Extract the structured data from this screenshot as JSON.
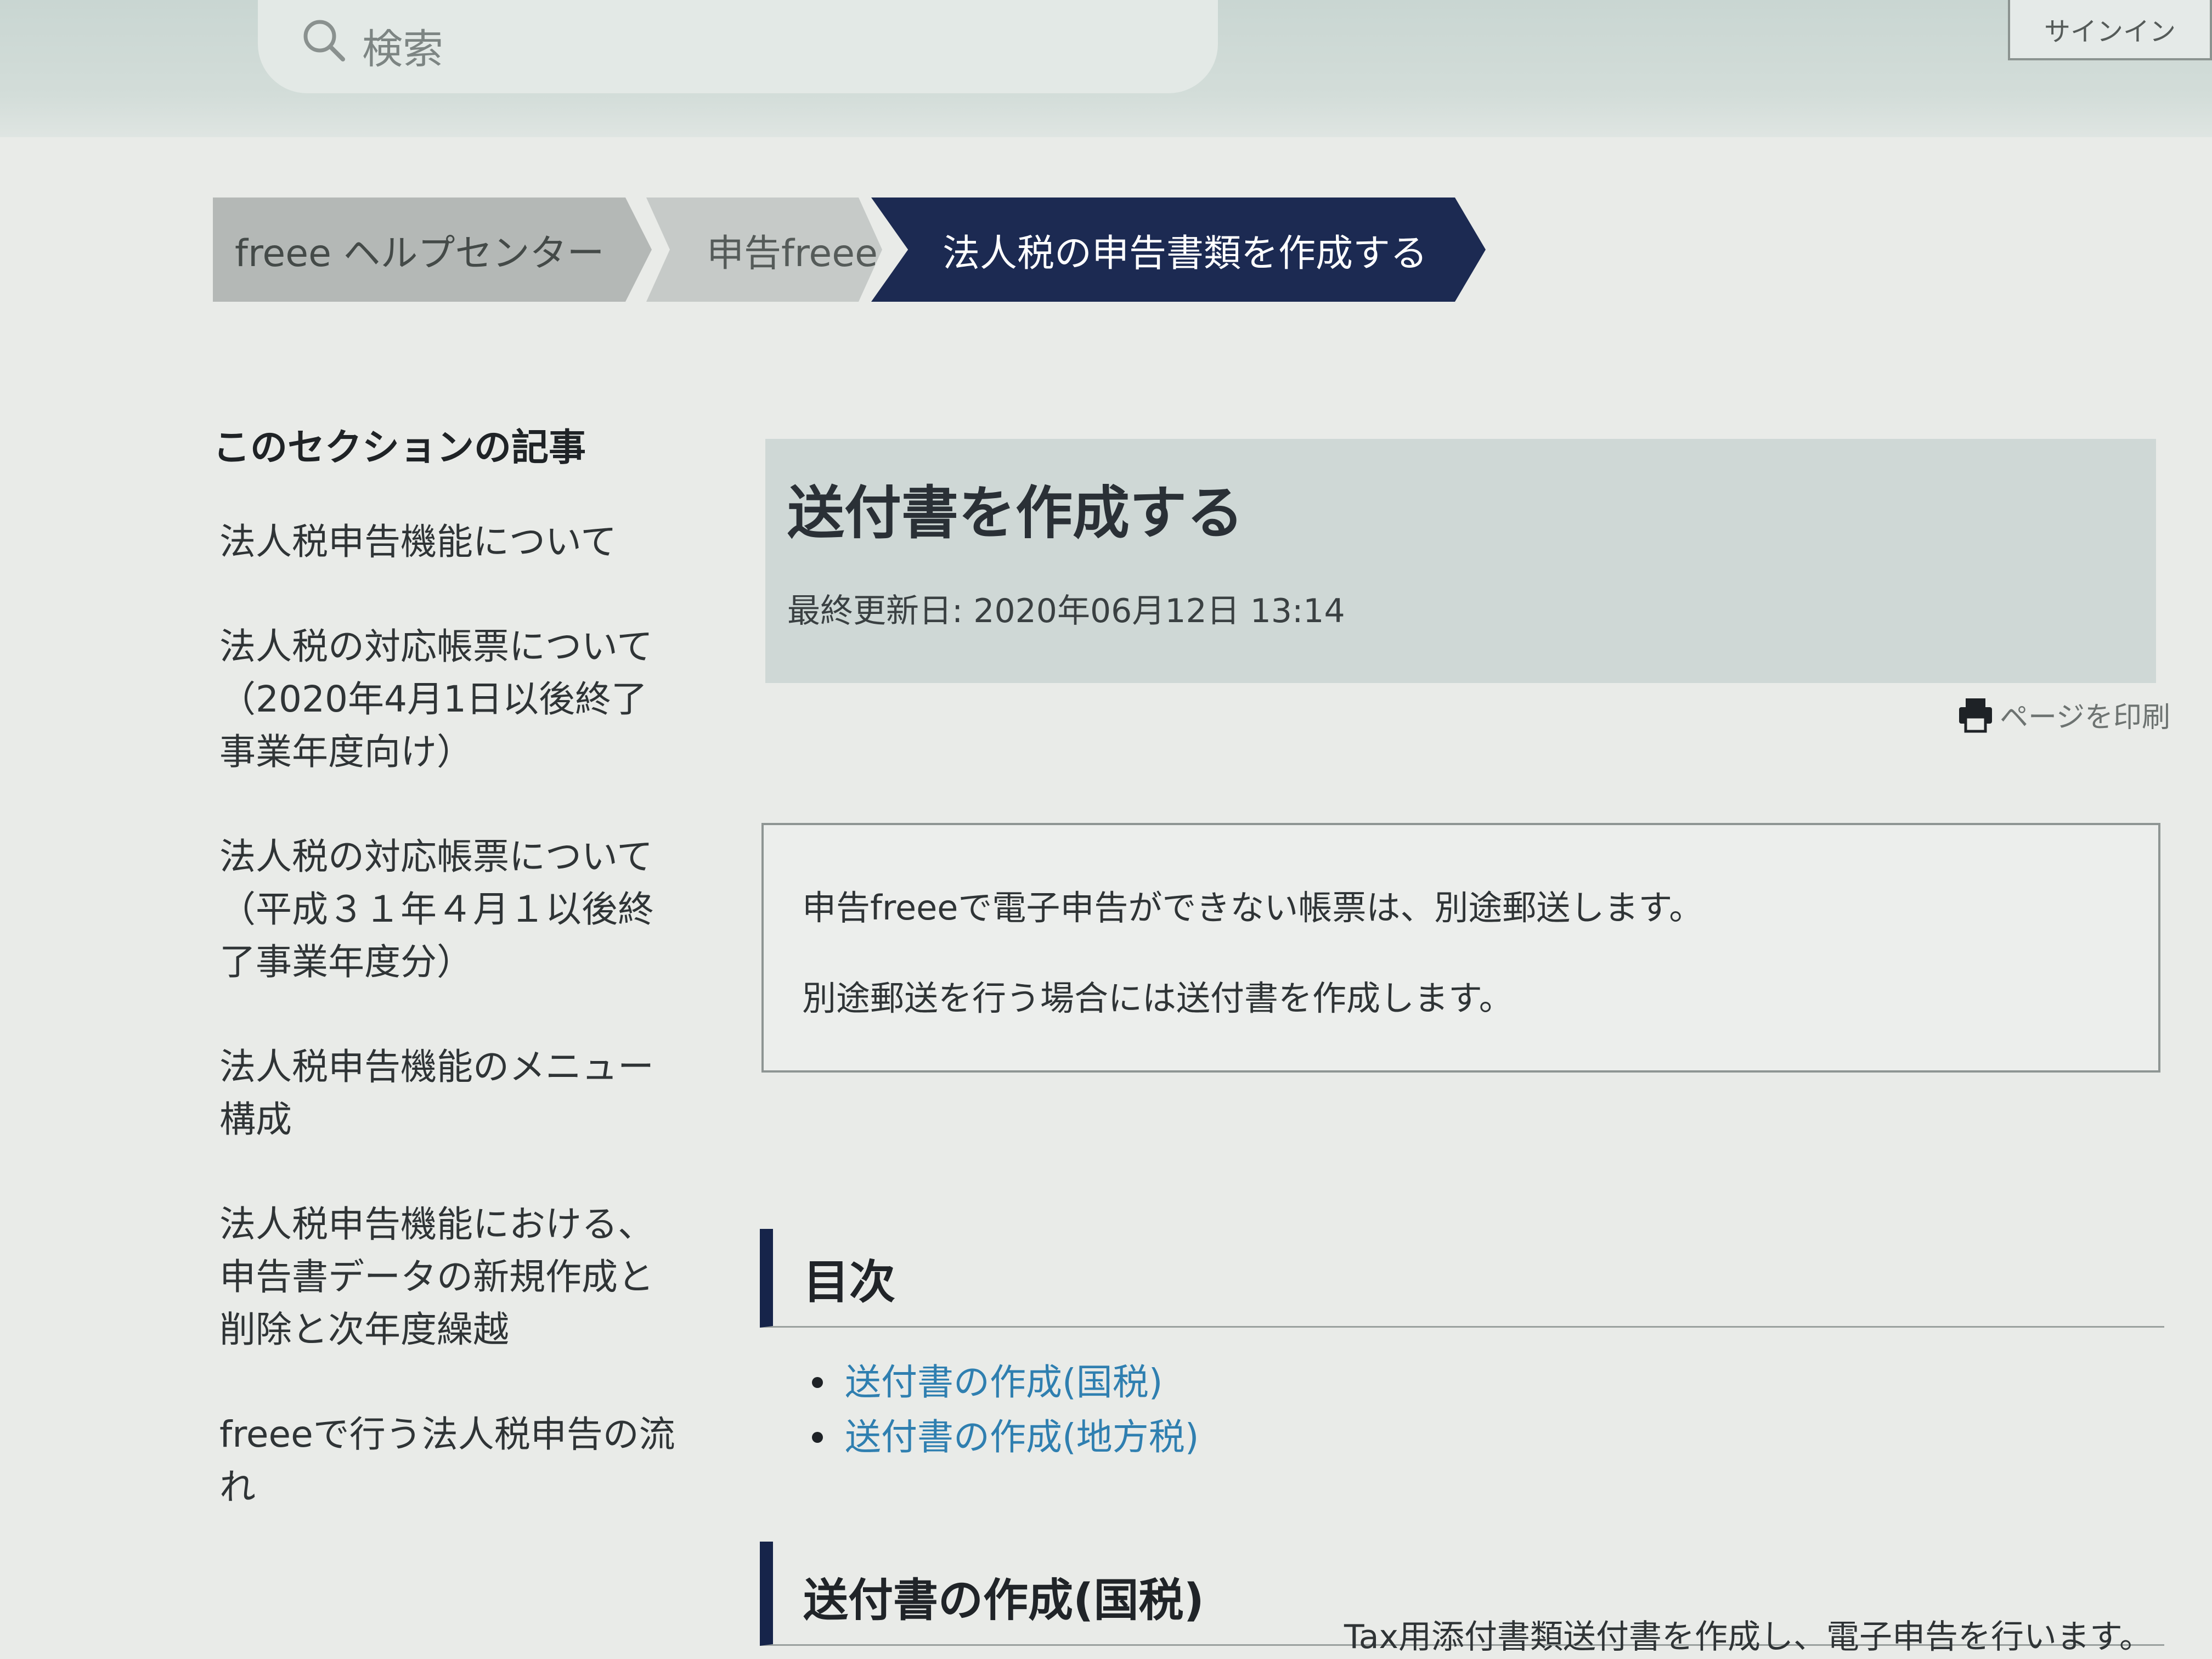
{
  "header": {
    "search_placeholder": "検索",
    "signin_label": "サインイン"
  },
  "breadcrumb": [
    {
      "label": "freee ヘルプセンター"
    },
    {
      "label": "申告freee"
    },
    {
      "label": "法人税の申告書類を作成する"
    }
  ],
  "sidebar": {
    "title": "このセクションの記事",
    "items": [
      {
        "label": "法人税申告機能について"
      },
      {
        "label": "法人税の対応帳票について（2020年4月1日以後終了事業年度向け）"
      },
      {
        "label": "法人税の対応帳票について（平成３１年４月１以後終了事業年度分）"
      },
      {
        "label": "法人税申告機能のメニュー構成"
      },
      {
        "label": "法人税申告機能における、申告書データの新規作成と削除と次年度繰越"
      },
      {
        "label": "freeeで行う法人税申告の流れ"
      }
    ]
  },
  "article": {
    "title": "送付書を作成する",
    "updated": "最終更新日: 2020年06月12日 13:14",
    "print_label": "ページを印刷",
    "notice": [
      "申告freeeで電子申告ができない帳票は、別途郵送します。",
      "別途郵送を行う場合には送付書を作成します。"
    ],
    "toc_heading": "目次",
    "toc": [
      {
        "label": "送付書の作成(国税)"
      },
      {
        "label": "送付書の作成(地方税)"
      }
    ],
    "section_heading": "送付書の作成(国税)",
    "section_body": "Tax用添付書類送付書を作成し、電子申告を行います。"
  },
  "colors": {
    "breadcrumb_active": "#1c2a52",
    "heading_bar": "#16244a",
    "link": "#2f7fb0"
  }
}
